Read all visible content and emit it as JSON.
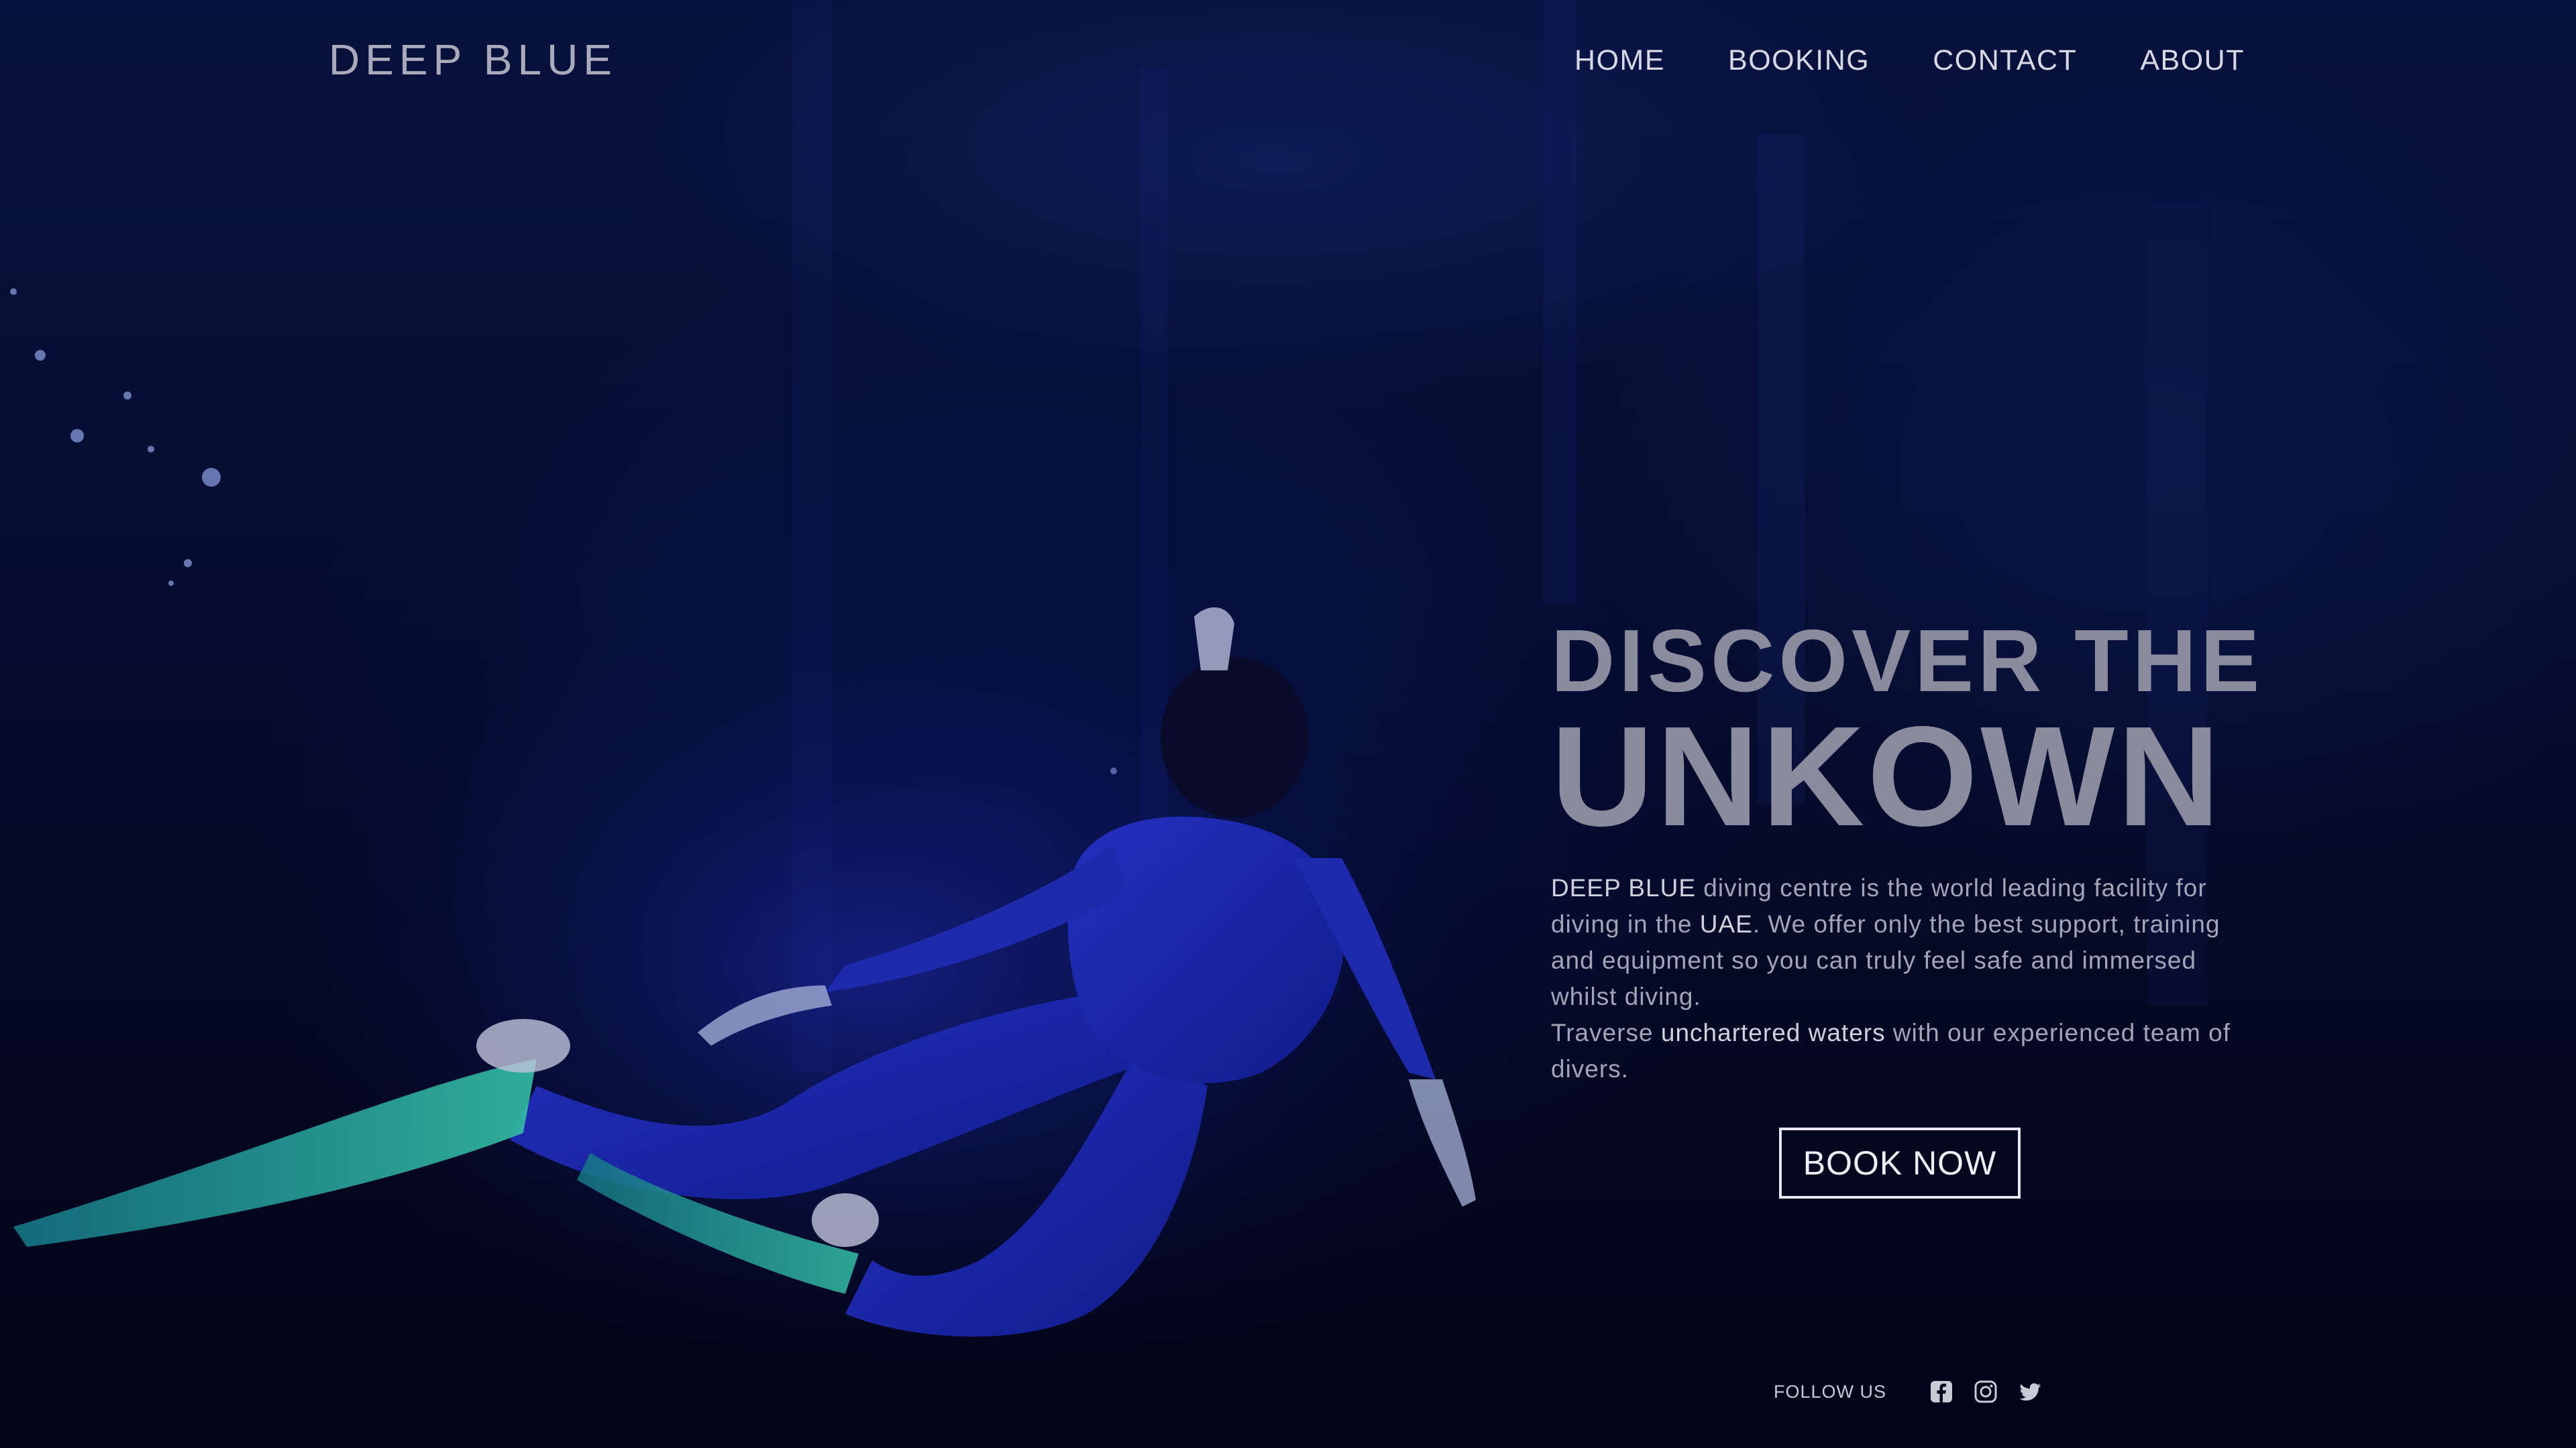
{
  "header": {
    "brand": "DEEP BLUE",
    "nav": [
      {
        "label": "HOME"
      },
      {
        "label": "BOOKING"
      },
      {
        "label": "CONTACT"
      },
      {
        "label": "ABOUT"
      }
    ]
  },
  "hero": {
    "headline_line1": "DISCOVER THE",
    "headline_line2": "UNKOWN",
    "description": {
      "p1_brand": "DEEP BLUE",
      "p1_a": " diving centre is the world leading facility for diving in the ",
      "p1_uae": "UAE",
      "p1_b": ". We offer only the best support, training and equipment so you can truly feel safe and immersed whilst diving.",
      "p2_a": "Traverse ",
      "p2_highlight": "unchartered waters",
      "p2_b": " with our experienced team of divers."
    },
    "cta_label": "BOOK NOW"
  },
  "footer": {
    "follow_label": "FOLLOW US",
    "social_icons": [
      "facebook-icon",
      "instagram-icon",
      "twitter-icon"
    ]
  },
  "colors": {
    "background": "#05081a",
    "headline": "#8a8c9e",
    "body_text": "#a2a4b8",
    "button_border": "#e6e7ef",
    "diver_suit": "#1f2fc8",
    "fins": "#2fb7b0"
  }
}
